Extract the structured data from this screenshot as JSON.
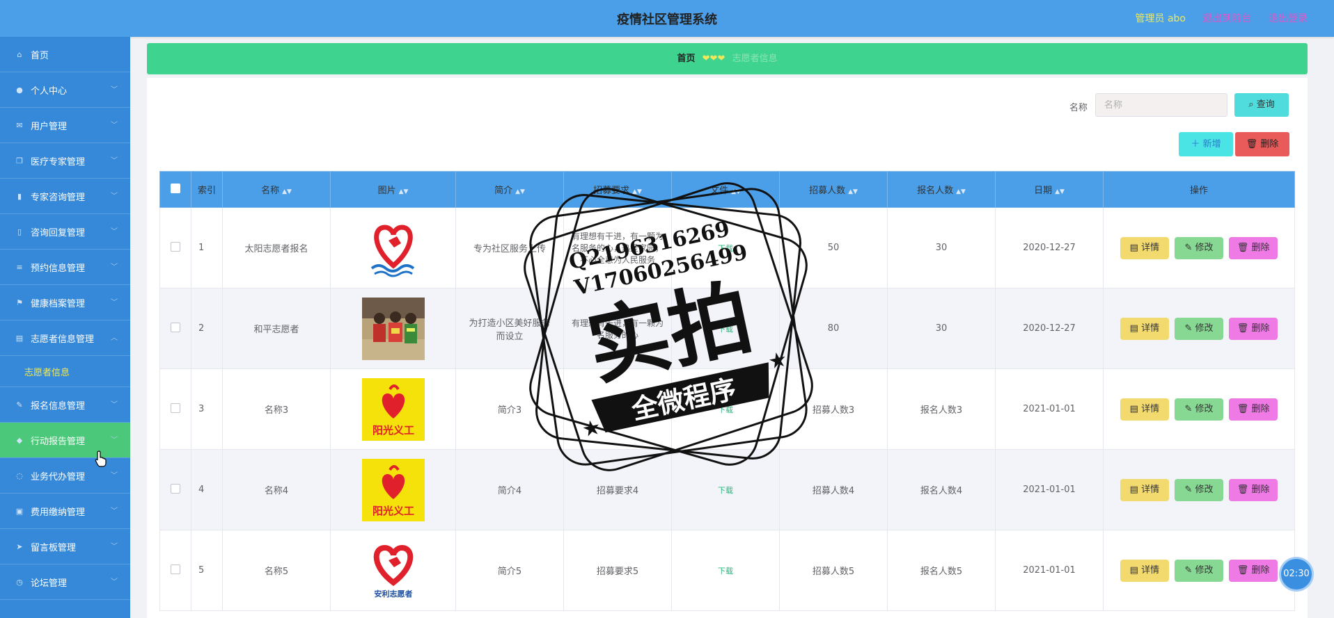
{
  "header": {
    "title": "疫情社区管理系统",
    "user": "管理员 abo",
    "back_front": "退出到前台",
    "logout": "退出登录"
  },
  "sidebar": {
    "items": [
      {
        "label": "首页",
        "icon": "home-icon"
      },
      {
        "label": "个人中心",
        "icon": "user-icon"
      },
      {
        "label": "用户管理",
        "icon": "mail-icon"
      },
      {
        "label": "医疗专家管理",
        "icon": "copy-icon"
      },
      {
        "label": "专家咨询管理",
        "icon": "bar-chart-icon"
      },
      {
        "label": "咨询回复管理",
        "icon": "phone-icon"
      },
      {
        "label": "预约信息管理",
        "icon": "sliders-icon"
      },
      {
        "label": "健康档案管理",
        "icon": "flag-icon"
      },
      {
        "label": "志愿者信息管理",
        "icon": "document-icon"
      },
      {
        "label": "报名信息管理",
        "icon": "edit-icon"
      },
      {
        "label": "行动报告管理",
        "icon": "bell-icon"
      },
      {
        "label": "业务代办管理",
        "icon": "power-icon"
      },
      {
        "label": "费用缴纳管理",
        "icon": "wallet-icon"
      },
      {
        "label": "留言板管理",
        "icon": "send-icon"
      },
      {
        "label": "论坛管理",
        "icon": "clock-icon"
      }
    ],
    "submenu_label": "志愿者信息",
    "active_index": 10
  },
  "breadcrumb": {
    "home": "首页",
    "separator": "❤❤❤",
    "current": "志愿者信息"
  },
  "search": {
    "label": "名称",
    "placeholder": "名称",
    "query_button": "查询",
    "add_button": "新增",
    "delete_button": "删除"
  },
  "table": {
    "headers": [
      "索引",
      "名称",
      "图片",
      "简介",
      "招募要求",
      "文件",
      "招募人数",
      "报名人数",
      "日期",
      "操作"
    ],
    "rows": [
      {
        "index": "1",
        "name": "太阳志愿者报名",
        "image": "heart-hands-logo",
        "intro": "专为社区服务上传",
        "req": "有理想有干进，有一颗为名服务的心，热爱家园，不心全意为人民服务",
        "file": "下载",
        "recruit": "50",
        "signup": "30",
        "date": "2020-12-27"
      },
      {
        "index": "2",
        "name": "和平志愿者",
        "image": "volunteers-photo",
        "intro": "为打造小区美好服务而设立",
        "req": "有理想有干进，有一颗为名服务的心",
        "file": "下载",
        "recruit": "80",
        "signup": "30",
        "date": "2020-12-27"
      },
      {
        "index": "3",
        "name": "名称3",
        "image": "sunshine-volunteer-logo",
        "intro": "简介3",
        "req": "招募要求3",
        "file": "下载",
        "recruit": "招募人数3",
        "signup": "报名人数3",
        "date": "2021-01-01"
      },
      {
        "index": "4",
        "name": "名称4",
        "image": "sunshine-volunteer-logo",
        "intro": "简介4",
        "req": "招募要求4",
        "file": "下载",
        "recruit": "招募人数4",
        "signup": "报名人数4",
        "date": "2021-01-01"
      },
      {
        "index": "5",
        "name": "名称5",
        "image": "anli-volunteer-logo",
        "intro": "简介5",
        "req": "招募要求5",
        "file": "下载",
        "recruit": "招募人数5",
        "signup": "报名人数5",
        "date": "2021-01-01"
      }
    ],
    "actions": {
      "detail": "详情",
      "edit": "修改",
      "remove": "删除"
    },
    "logo_text_sunshine": "阳光义工",
    "logo_text_anli": "安利志愿者"
  },
  "watermark": {
    "line1": "Q2196316269",
    "line2": "V17060256499",
    "big": "实拍",
    "banner": "全微程序"
  },
  "timer": "02:30",
  "colors": {
    "header": "#4a9fe8",
    "sidebar": "#3689d8",
    "active": "#4cc87a",
    "breadcrumb": "#3ed38f"
  }
}
